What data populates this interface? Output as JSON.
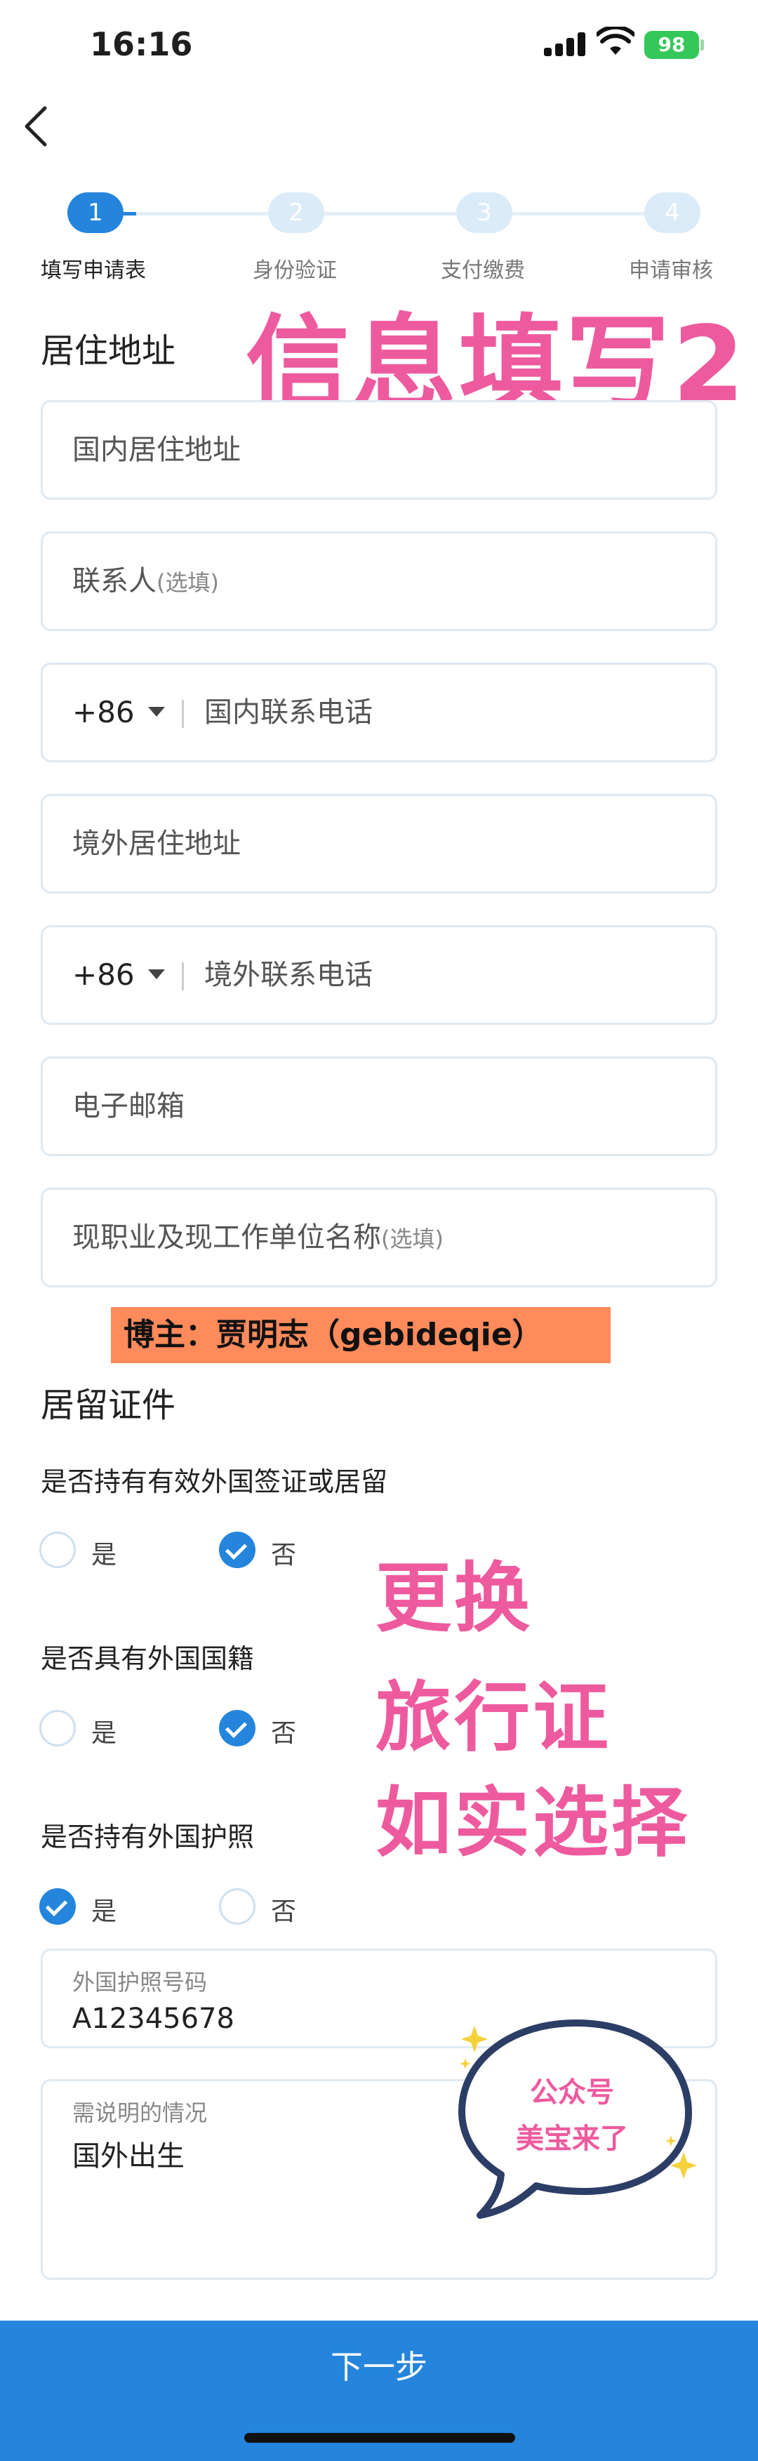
{
  "status_bar": {
    "time": "16:16",
    "battery": "98"
  },
  "stepper": {
    "steps": [
      {
        "num": "1",
        "label": "填写申请表"
      },
      {
        "num": "2",
        "label": "身份验证"
      },
      {
        "num": "3",
        "label": "支付缴费"
      },
      {
        "num": "4",
        "label": "申请审核"
      }
    ]
  },
  "residence": {
    "title": "居住地址",
    "overlay": "信息填写2",
    "domestic_address": "国内居住地址",
    "contact_person": "联系人",
    "optional": "(选填)",
    "country_code": "+86",
    "domestic_phone": "国内联系电话",
    "overseas_address": "境外居住地址",
    "overseas_phone": "境外联系电话",
    "email": "电子邮箱",
    "occupation": "现职业及现工作单位名称"
  },
  "blogger": "博主：贾明志（gebideqie）",
  "residence_permit": {
    "title": "居留证件",
    "yes": "是",
    "no": "否",
    "q1": "是否持有有效外国签证或居留",
    "q2": "是否具有外国国籍",
    "q3": "是否持有外国护照",
    "overlay_lines": [
      "更换",
      "旅行证",
      "如实选择"
    ],
    "passport_label": "外国护照号码",
    "passport_value": "A12345678",
    "note_label": "需说明的情况",
    "note_value": "国外出生"
  },
  "sticker": {
    "line1": "公众号",
    "line2": "美宝来了"
  },
  "footer": {
    "next_label": "下一步"
  },
  "colors": {
    "accent": "#2585dc",
    "overlay_pink": "#ee5a9e",
    "banner": "#ff8b5c"
  }
}
